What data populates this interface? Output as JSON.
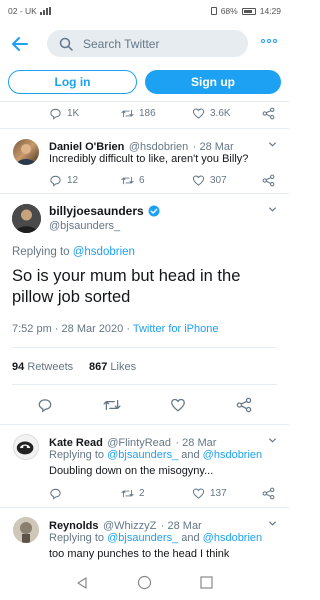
{
  "status_bar": {
    "carrier": "02 - UK",
    "battery": "68%",
    "time": "14:29"
  },
  "search": {
    "placeholder": "Search Twitter"
  },
  "auth": {
    "login_label": "Log in",
    "signup_label": "Sign up"
  },
  "prev_tweet_actions": {
    "replies": "1K",
    "retweets": "186",
    "likes": "3.6K"
  },
  "reply1": {
    "name": "Daniel O'Brien",
    "handle": "@hsdobrien",
    "date": "· 28 Mar",
    "text": "Incredibly difficult to like, aren't you Billy?",
    "replies": "12",
    "retweets": "6",
    "likes": "307"
  },
  "main_tweet": {
    "name": "billyjoesaunders",
    "handle": "@bjsaunders_",
    "replying_prefix": "Replying to ",
    "replying_to": "@hsdobrien",
    "text": "So is your mum but head in the pillow job sorted",
    "timestamp": "7:52 pm · 28 Mar 2020 · ",
    "source": "Twitter for iPhone",
    "retweets_count": "94",
    "retweets_label": "Retweets",
    "likes_count": "867",
    "likes_label": "Likes"
  },
  "reply2": {
    "name": "Kate Read",
    "handle": "@FlintyRead",
    "date": "· 28 Mar",
    "replying_prefix": "Replying to ",
    "mention1": "@bjsaunders_",
    "and": " and ",
    "mention2": "@hsdobrien",
    "text": "Doubling down on the misogyny...",
    "retweets": "2",
    "likes": "137"
  },
  "reply3": {
    "name": "Reynolds",
    "handle": "@WhizzyZ",
    "date": "· 28 Mar",
    "replying_prefix": "Replying to ",
    "mention1": "@bjsaunders_",
    "and": " and ",
    "mention2": "@hsdobrien",
    "text": "too many punches to the head I think"
  },
  "colors": {
    "accent": "#1da1f2",
    "text": "#14171a",
    "muted": "#657786",
    "divider": "#e6ecf0"
  }
}
